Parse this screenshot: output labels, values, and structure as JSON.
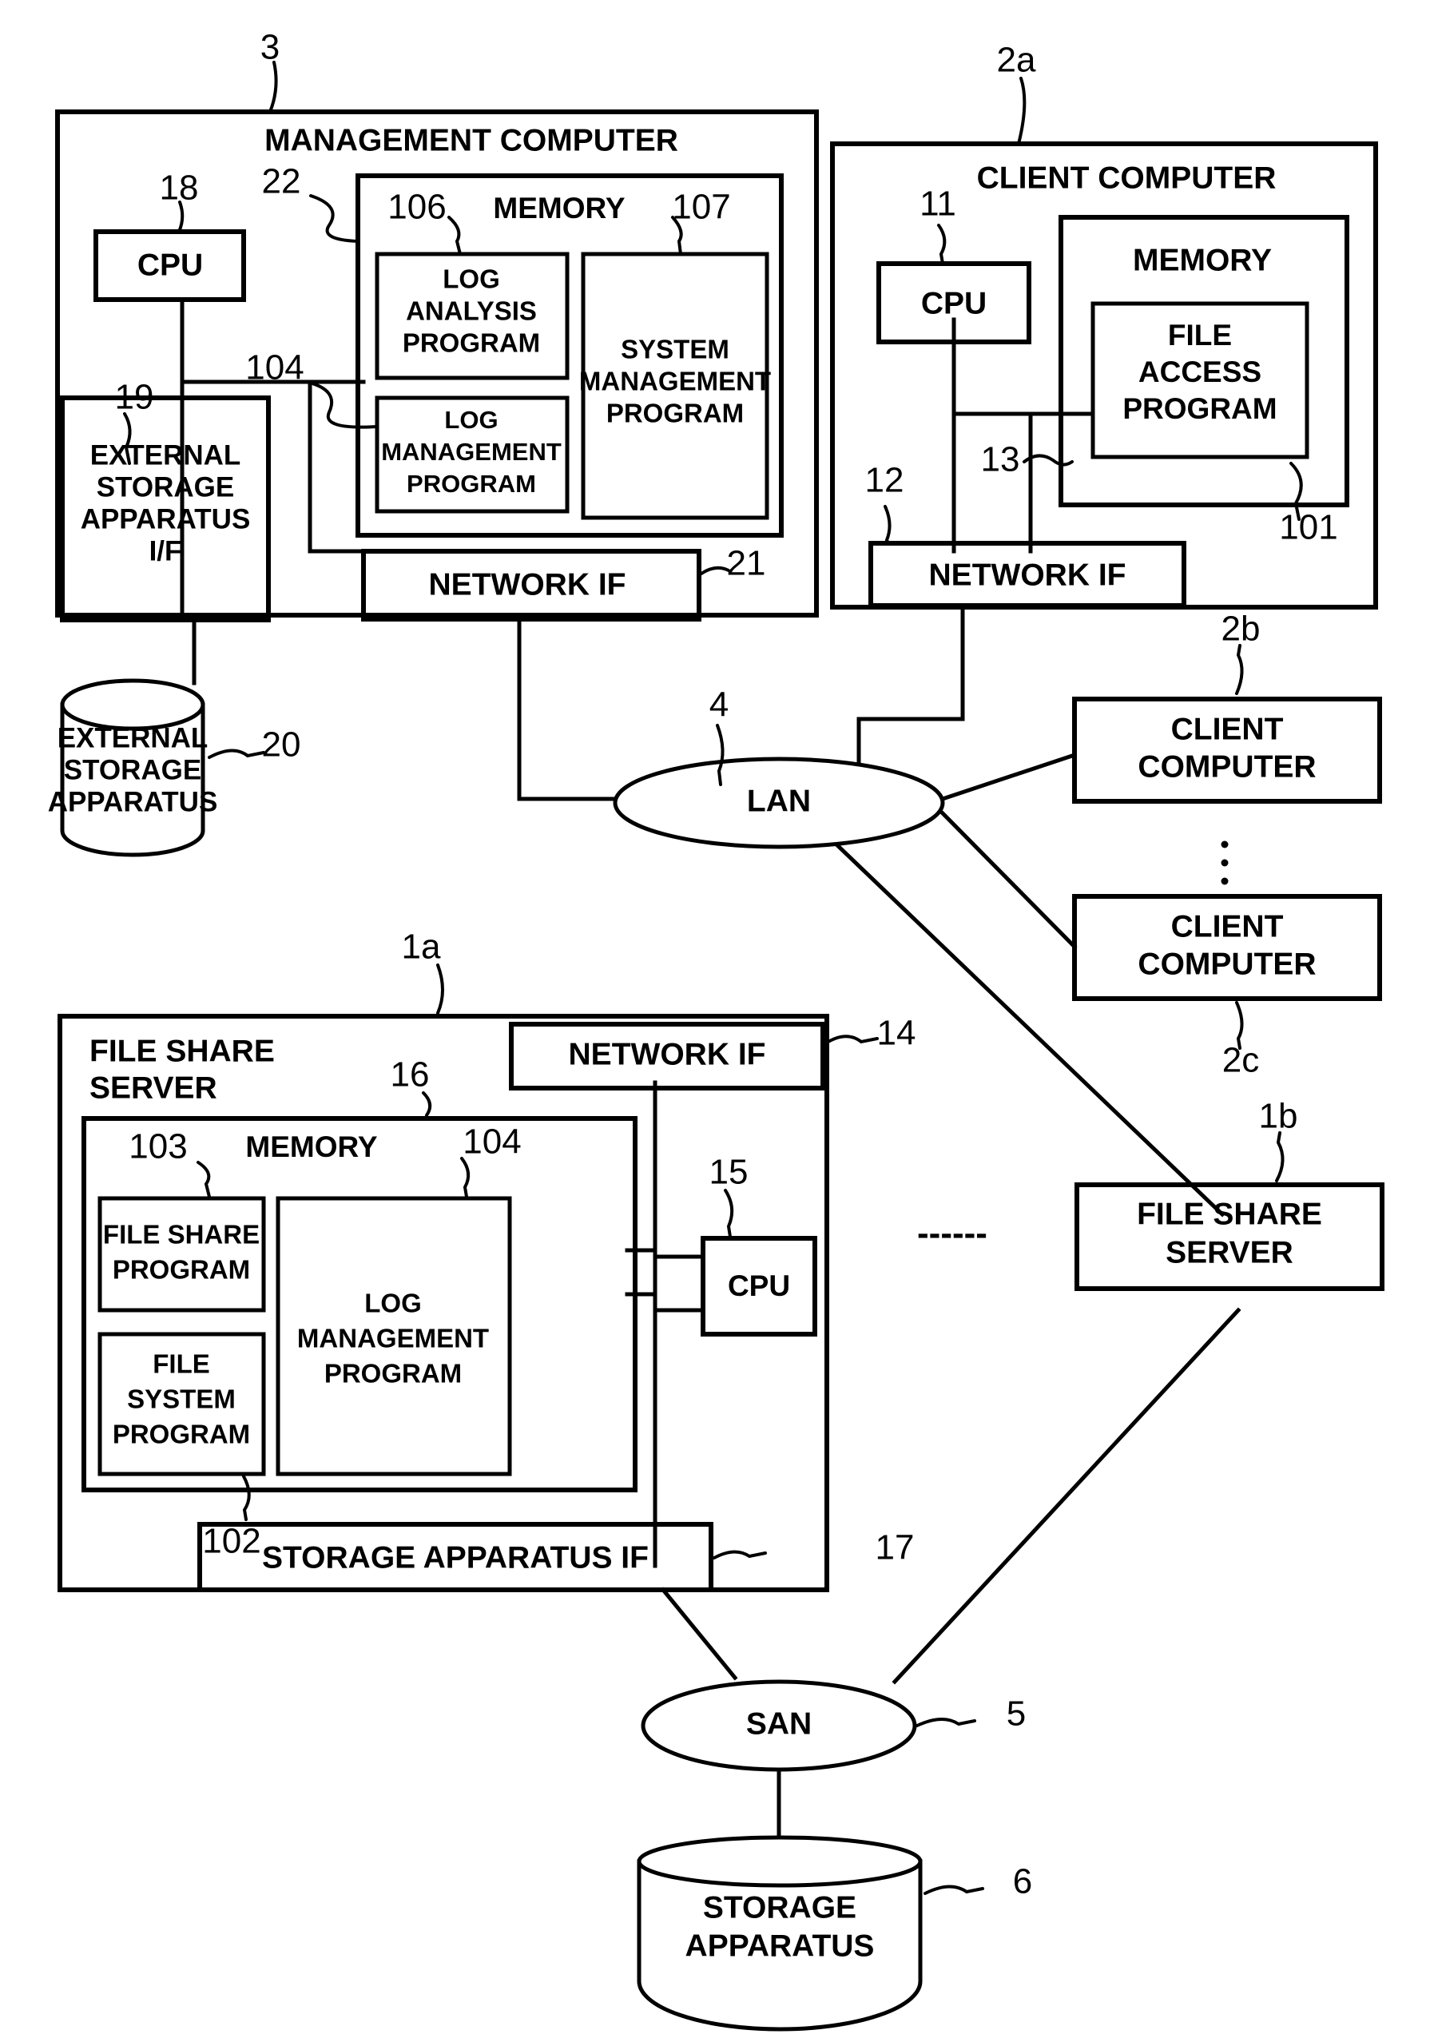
{
  "figure": {
    "type": "patent-system-block-diagram",
    "background": "#ffffff",
    "stroke": "#000000"
  },
  "management_computer": {
    "ref": "3",
    "title": "MANAGEMENT COMPUTER",
    "cpu": {
      "label": "CPU",
      "ref": "18"
    },
    "external_storage_if": {
      "label": "EXTERNAL STORAGE APPARATUS I/F",
      "line1": "EXTERNAL",
      "line2": "STORAGE",
      "line3": "APPARATUS",
      "line4": "I/F",
      "ref": "19"
    },
    "memory": {
      "label": "MEMORY",
      "ref": "22",
      "programs": [
        {
          "ref": "106",
          "line1": "LOG",
          "line2": "ANALYSIS",
          "line3": "PROGRAM"
        },
        {
          "ref": "104",
          "line1": "LOG",
          "line2": "MANAGEMENT",
          "line3": "PROGRAM"
        },
        {
          "ref": "107",
          "line1": "SYSTEM",
          "line2": "MANAGEMENT",
          "line3": "PROGRAM"
        }
      ]
    },
    "network_if": {
      "label": "NETWORK IF",
      "ref": "21"
    }
  },
  "external_storage_apparatus": {
    "ref": "20",
    "line1": "EXTERNAL",
    "line2": "STORAGE",
    "line3": "APPARATUS"
  },
  "client_computer_a": {
    "ref": "2a",
    "title": "CLIENT COMPUTER",
    "cpu": {
      "label": "CPU",
      "ref": "11"
    },
    "memory": {
      "label": "MEMORY",
      "ref": "101"
    },
    "file_access_program": {
      "ref": "13",
      "line1": "FILE",
      "line2": "ACCESS",
      "line3": "PROGRAM"
    },
    "network_if": {
      "label": "NETWORK IF",
      "ref": "12"
    }
  },
  "client_computer_b": {
    "ref": "2b",
    "line1": "CLIENT",
    "line2": "COMPUTER"
  },
  "client_computer_c": {
    "ref": "2c",
    "line1": "CLIENT",
    "line2": "COMPUTER"
  },
  "client_ellipsis": "⋮",
  "lan": {
    "label": "LAN",
    "ref": "4"
  },
  "san": {
    "label": "SAN",
    "ref": "5"
  },
  "file_share_server_a": {
    "ref": "1a",
    "title_line1": "FILE SHARE",
    "title_line2": "SERVER",
    "network_if": {
      "label": "NETWORK IF",
      "ref": "14"
    },
    "memory": {
      "label": "MEMORY",
      "ref": "16"
    },
    "file_share_program": {
      "ref": "103",
      "line1": "FILE SHARE",
      "line2": "PROGRAM"
    },
    "file_system_program": {
      "ref": "102",
      "line1": "FILE",
      "line2": "SYSTEM",
      "line3": "PROGRAM"
    },
    "log_management_program": {
      "ref": "104",
      "line1": "LOG",
      "line2": "MANAGEMENT",
      "line3": "PROGRAM"
    },
    "cpu": {
      "label": "CPU",
      "ref": "15"
    },
    "storage_apparatus_if": {
      "label": "STORAGE APPARATUS IF",
      "ref": "17"
    }
  },
  "file_share_server_b": {
    "ref": "1b",
    "line1": "FILE SHARE",
    "line2": "SERVER"
  },
  "server_ellipsis": "------",
  "storage_apparatus": {
    "ref": "6",
    "line1": "STORAGE",
    "line2": "APPARATUS"
  }
}
